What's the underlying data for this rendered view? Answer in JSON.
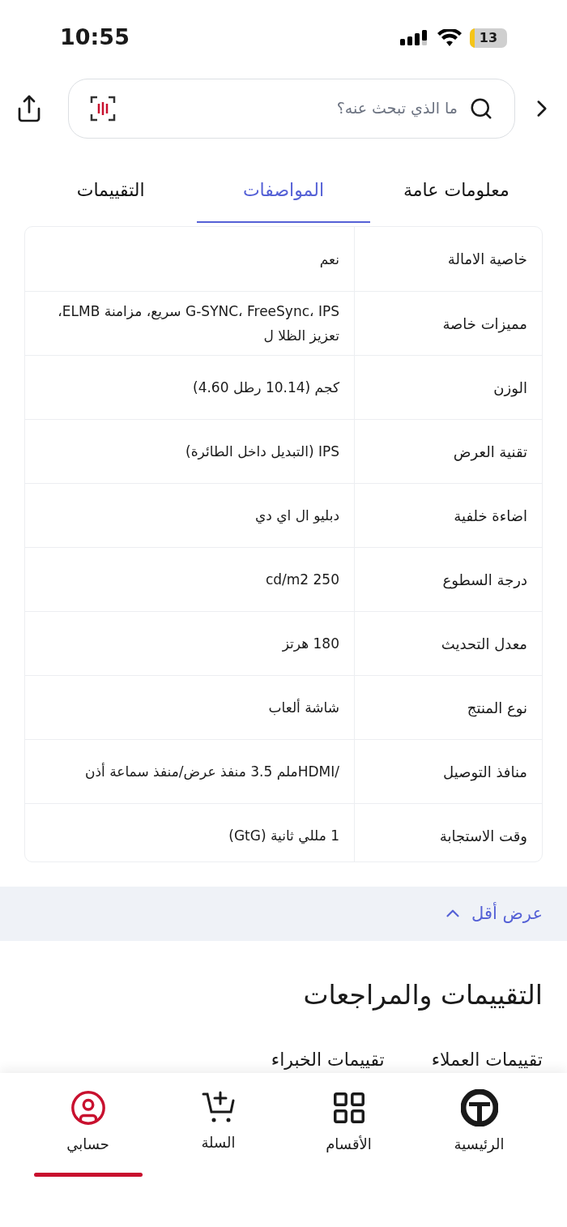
{
  "status_bar": {
    "time": "10:55",
    "battery": "13"
  },
  "search": {
    "placeholder": "ما الذي تبحث عنه؟"
  },
  "tabs": [
    {
      "label": "معلومات عامة",
      "selected": false
    },
    {
      "label": "المواصفات",
      "selected": true
    },
    {
      "label": "التقييمات",
      "selected": false
    }
  ],
  "specs": [
    {
      "name": "خاصية الامالة",
      "value": "نعم"
    },
    {
      "name": "مميزات خاصة",
      "value": "G-SYNC، FreeSync، IPS سريع، مزامنة ELMB، تعزيز الظلا ل"
    },
    {
      "name": "الوزن",
      "value": "كجم (10.14 رطل 4.60)"
    },
    {
      "name": "تقنية العرض",
      "value": "IPS (التبديل داخل الطائرة)"
    },
    {
      "name": "اضاءة خلفية",
      "value": "دبليو ال اي دي"
    },
    {
      "name": "درجة السطوع",
      "value": "cd/m2 250"
    },
    {
      "name": "معدل التحديث",
      "value": "180 هرتز"
    },
    {
      "name": "نوع المنتج",
      "value": "شاشة ألعاب"
    },
    {
      "name": "منافذ التوصيل",
      "value": "/HDMIملم 3.5 منفذ عرض/منفذ سماعة أذن"
    },
    {
      "name": "وقت الاستجابة",
      "value": "1 مللي ثانية (GtG)"
    }
  ],
  "show_less": "عرض أقل",
  "reviews": {
    "title": "التقييمات والمراجعات",
    "tabs": [
      "تقييمات العملاء",
      "تقييمات الخبراء"
    ]
  },
  "bottom_nav": [
    {
      "label": "الرئيسية",
      "selected": false
    },
    {
      "label": "الأقسام",
      "selected": false
    },
    {
      "label": "السلة",
      "selected": false
    },
    {
      "label": "حسابي",
      "selected": true
    }
  ]
}
